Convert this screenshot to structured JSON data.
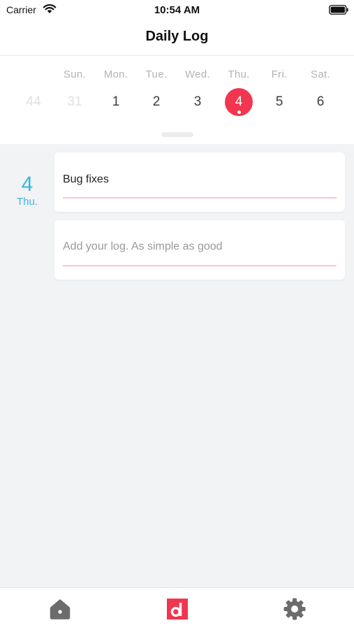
{
  "status_bar": {
    "carrier": "Carrier",
    "time": "10:54 AM"
  },
  "nav": {
    "title": "Daily Log"
  },
  "week": {
    "days": [
      {
        "name": "",
        "number": "44",
        "state": "faded"
      },
      {
        "name": "Sun.",
        "number": "31",
        "state": "faded"
      },
      {
        "name": "Mon.",
        "number": "1",
        "state": "normal"
      },
      {
        "name": "Tue.",
        "number": "2",
        "state": "normal"
      },
      {
        "name": "Wed.",
        "number": "3",
        "state": "normal"
      },
      {
        "name": "Thu.",
        "number": "4",
        "state": "selected"
      },
      {
        "name": "Fri.",
        "number": "5",
        "state": "normal"
      },
      {
        "name": "Sat.",
        "number": "6",
        "state": "normal"
      }
    ]
  },
  "entry": {
    "date_number": "4",
    "date_day": "Thu.",
    "logs": [
      {
        "text": "Bug fixes"
      }
    ],
    "new_log_placeholder": "Add your log. As simple as good"
  },
  "tabs": [
    {
      "icon": "home-icon"
    },
    {
      "icon": "daily-log-icon"
    },
    {
      "icon": "gear-icon"
    }
  ],
  "colors": {
    "accent": "#f2364f",
    "date_blue": "#39b6e6",
    "underline": "#f6c8cd",
    "background": "#f2f3f5"
  }
}
